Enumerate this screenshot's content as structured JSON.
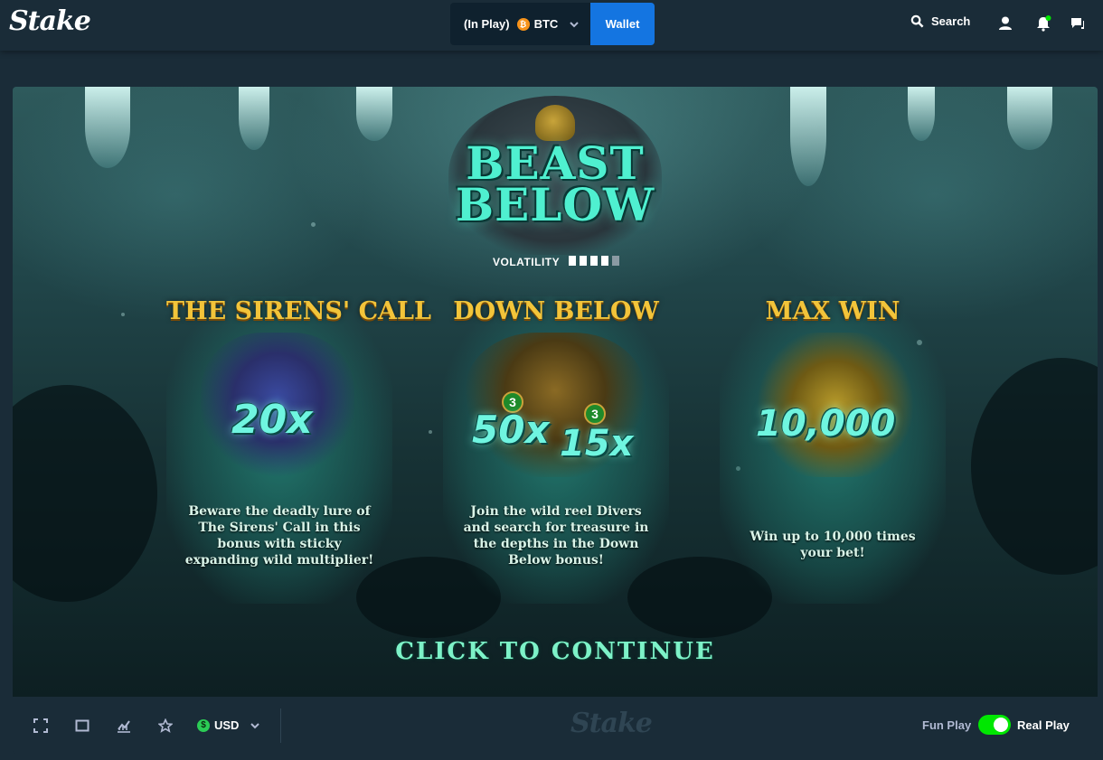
{
  "header": {
    "logo": "Stake",
    "balance_prefix": "(In Play)",
    "currency": "BTC",
    "currency_glyph": "₿",
    "wallet_label": "Wallet",
    "search_label": "Search",
    "icons": [
      "search-icon",
      "user-icon",
      "bell-icon",
      "chat-icon"
    ],
    "notification_dot_color": "#00e701"
  },
  "game": {
    "title": "BEAST BELOW",
    "volatility_label": "VOLATILITY",
    "panels": [
      {
        "title": "THE SIRENS' CALL",
        "multipliers": [
          "20x"
        ],
        "description": "Beware the deadly lure of The Sirens' Call in this bonus with sticky expanding wild multiplier!"
      },
      {
        "title": "DOWN BELOW",
        "multipliers": [
          "50x",
          "15x"
        ],
        "badges": [
          "3",
          "3"
        ],
        "description": "Join the wild reel Divers and search for treasure in the depths in the Down Below bonus!"
      },
      {
        "title": "MAX WIN",
        "multipliers": [
          "10,000"
        ],
        "description": "Win up to 10,000 times your bet!"
      }
    ],
    "cta": "CLICK TO CONTINUE"
  },
  "footer": {
    "currency": "USD",
    "currency_glyph": "$",
    "logo": "Stake",
    "fun_label": "Fun Play",
    "real_label": "Real Play",
    "real_play_on": true,
    "toggle_color": "#00e701",
    "icons": [
      "fullscreen-icon",
      "theatre-mode-icon",
      "stats-icon",
      "favourite-star-icon"
    ]
  }
}
